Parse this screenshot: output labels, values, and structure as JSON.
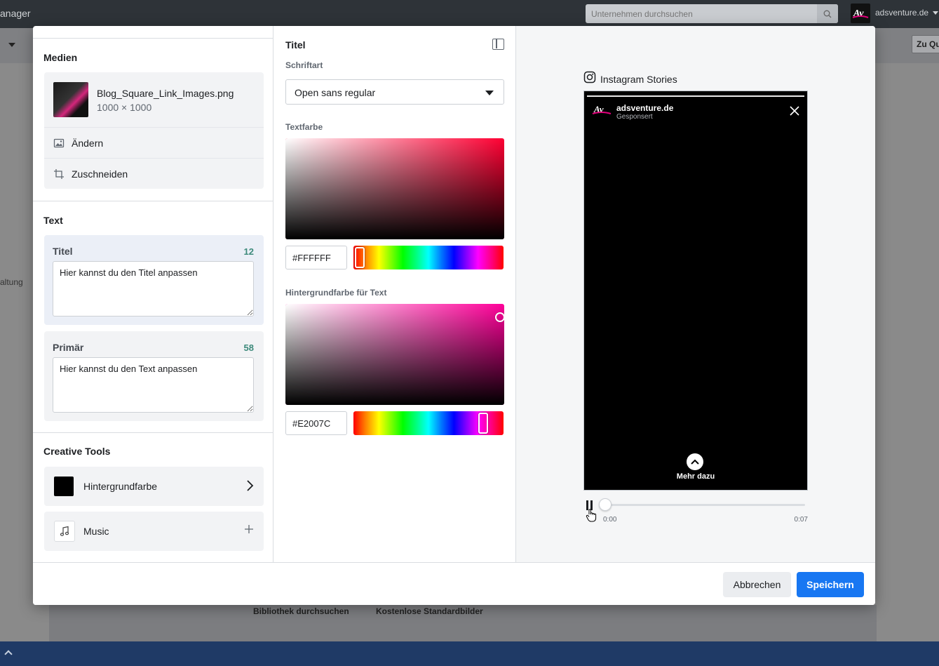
{
  "background": {
    "app_name": "anager",
    "search_placeholder": "Unternehmen durchsuchen",
    "account_name": "adsventure.de",
    "quick_button": "Zu Qu",
    "side_text": "altung",
    "bottom_tabs": [
      "Bibliothek durchsuchen",
      "Kostenlose Standardbilder"
    ]
  },
  "left": {
    "media_title": "Medien",
    "file_name": "Blog_Square_Link_Images.png",
    "file_size": "1000 × 1000",
    "change_label": "Ändern",
    "crop_label": "Zuschneiden",
    "text_title": "Text",
    "titel_label": "Titel",
    "titel_count": "12",
    "titel_value": "Hier kannst du den Titel anpassen",
    "primar_label": "Primär",
    "primar_count": "58",
    "primar_value": "Hier kannst du den Text anpassen",
    "tools_title": "Creative Tools",
    "bg_color_label": "Hintergrundfarbe",
    "music_label": "Music"
  },
  "mid": {
    "title": "Titel",
    "font_label": "Schriftart",
    "font_value": "Open sans regular",
    "text_color_label": "Textfarbe",
    "text_color_hex": "#FFFFFF",
    "text_color_hue": "#ff0033",
    "bg_color_label": "Hintergrundfarbe für Text",
    "bg_color_hex": "#E2007C",
    "bg_color_hue": "#ff0099"
  },
  "preview": {
    "placement": "Instagram Stories",
    "brand": "adsventure.de",
    "sponsored": "Gesponsert",
    "cta": "Mehr dazu",
    "time_start": "0:00",
    "time_end": "0:07"
  },
  "footer": {
    "cancel": "Abbrechen",
    "save": "Speichern"
  },
  "colors": {
    "accent": "#1877f2",
    "count": "#3d8a7b"
  }
}
